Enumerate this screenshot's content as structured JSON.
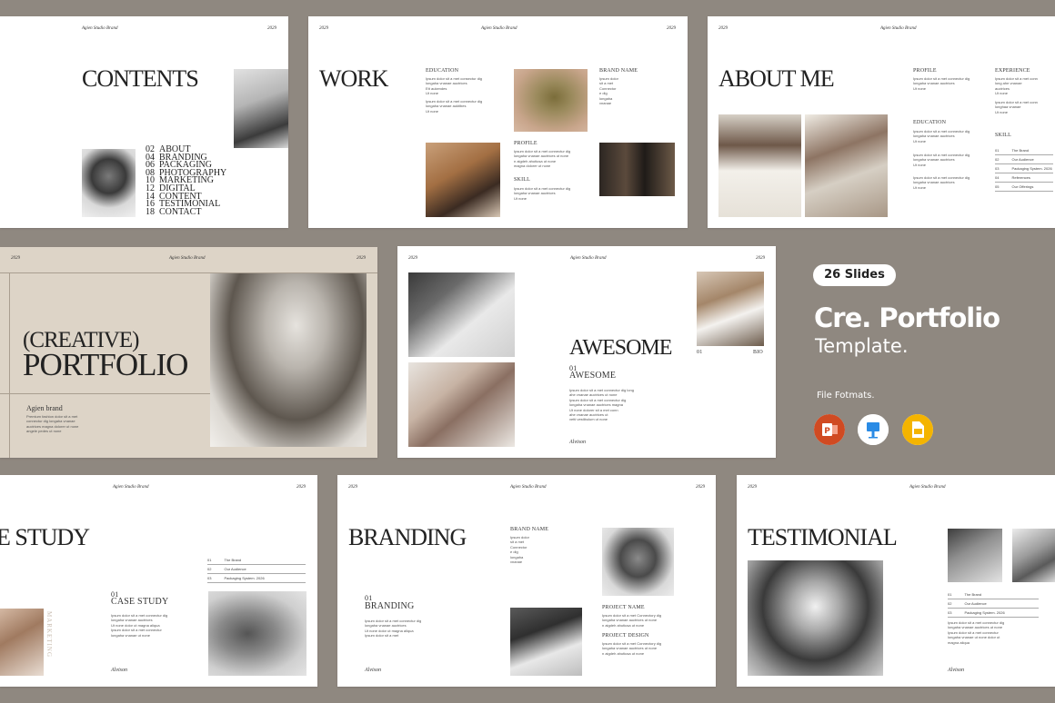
{
  "colors": {
    "background": "#8f8880",
    "slide": "#ffffff",
    "beige": "#ddd4c7",
    "powerpoint": "#d04a22",
    "keynote": "#2a8be5",
    "slides": "#f4b400"
  },
  "common": {
    "brand": "Agien Studio Brand",
    "year": "2029",
    "signature": "Alvison"
  },
  "contents": {
    "title": "CONTENTS",
    "items": [
      [
        "02",
        "ABOUT"
      ],
      [
        "04",
        "BRANDING"
      ],
      [
        "06",
        "PACKAGING"
      ],
      [
        "08",
        "PHOTOGRAPHY"
      ],
      [
        "10",
        "MARKETING"
      ],
      [
        "12",
        "DIGITAL"
      ],
      [
        "14",
        "CONTENT"
      ],
      [
        "16",
        "TESTIMONIAL"
      ],
      [
        "18",
        "CONTACT"
      ]
    ]
  },
  "work": {
    "title": "WORK",
    "education": "EDUCATION",
    "brandname": "BRAND NAME",
    "profile": "PROFILE",
    "skill": "SKILL",
    "para1": "Ipsum dolor sit a met consectur dig\nlongaha vnanae auctrices\nEtt aukendes\nUt none",
    "para2": "Ipsum dolor sit a met connectur dig\nlongaha vnanae auktibes\nUt none",
    "brandlist": "Ipsum dolor\nsit a met\nConnector\ne dig\nlongaha\nvnanae",
    "profpara": "Ipsum dolor sit a met connectur dig\nlongaha vnanae auctrices ut none\nn aigdeh ahutiusa ut none\nmagna dolorer ut none",
    "skillpara": "Ipsum dolor sit a met connectur dig\nlongaha vnanae auctrices\nUt none"
  },
  "about": {
    "title": "ABOUT ME",
    "profile": "PROFILE",
    "experience": "EXPERIENCE",
    "education": "EDUCATION",
    "skill": "SKILL",
    "para": "Ipsum dolor sit a met connectur dig\nlongaha vnanae auctrices\nUt none",
    "expara": "Ipsum dolor sit a met conn\nlong ahe vnanae\nauctrices\nUt none",
    "expara2": "Ipsum dolor sit a met conn\nlonghaa vnanae\nUt none",
    "skills": [
      [
        "01",
        "The Brand"
      ],
      [
        "02",
        "Our Audience"
      ],
      [
        "03",
        "Packaging System. 2026"
      ],
      [
        "04",
        "References"
      ],
      [
        "05",
        "Our Offerings"
      ]
    ]
  },
  "cover": {
    "line1": "(CREATIVE)",
    "line2": "PORTFOLIO",
    "brandname": "Agien brand",
    "para": "Premium fashion dolor sit a met\nconnectur dig longaha vnanae\nauctrices magna dolorer ut none\nangele pedes ut none"
  },
  "awesome": {
    "title": "AWESOME",
    "sub1": "01",
    "sub2": "AWESOME",
    "foot_left": "01",
    "foot_right": "BIO",
    "para": "Ipsum dolor sit a met connectur dig long\nahe vnanae auctrices ut none\nIpsum dolor sit a met connectur dig\nlongaha vnanae auctrices magna\nUt none dolorer sit a met conn\nahe vnanae auctrices ut\nvetti vestibulum ut none"
  },
  "casestudy": {
    "title": "E STUDY",
    "sub1": "01",
    "sub2": "CASE STUDY",
    "para": "Ipsum dolor sit a met connectur dig\nlongaha vnanae auctrices\nUt none dolor ut magna aliqua\nIpsum dolor sit a met connectur\nlongaha vnanae ut none",
    "list": [
      [
        "01",
        "The Brand"
      ],
      [
        "02",
        "Our Audience"
      ],
      [
        "03",
        "Packaging System. 2026"
      ]
    ],
    "vertical": "MARKETING"
  },
  "branding": {
    "title": "BRANDING",
    "sub1": "01",
    "sub2": "BRANDING",
    "brandname": "BRAND NAME",
    "projname": "PROJECT NAME",
    "projdesign": "PROJECT DESIGN",
    "brandlist": "Ipsum dolor\nsit a met\nConnector\ne dig\nlongaha\nvnanae",
    "para": "Ipsum dolor sit a met connectur dig\nlongaha vnanae auctrices\nUt none dolor ut magna aliqua\nIpsum dolor sit a met",
    "projpara": "Ipsum dolor sit a met Connectory dig\nlongaha vnanae auctrices ut none\nn aigdeh ahutiusa ut none"
  },
  "testimonial": {
    "title": "TESTIMONIAL",
    "list": [
      [
        "01",
        "The Brand"
      ],
      [
        "02",
        "Our Audience"
      ],
      [
        "03",
        "Packaging System. 2026"
      ]
    ],
    "para": "Ipsum dolor sit a met connectur dig\nlongaha vnanae auctrices ut none\nIpsum dolor sit a met connectur\nlongaha vnanae ut none dolor ut\nmagna aliqua"
  },
  "panel": {
    "badge": "26 Slides",
    "title1": "Cre. Portfolio",
    "title2": "Template.",
    "formats": "File Fotmats.",
    "icons": [
      "powerpoint-icon",
      "keynote-icon",
      "google-slides-icon"
    ]
  }
}
